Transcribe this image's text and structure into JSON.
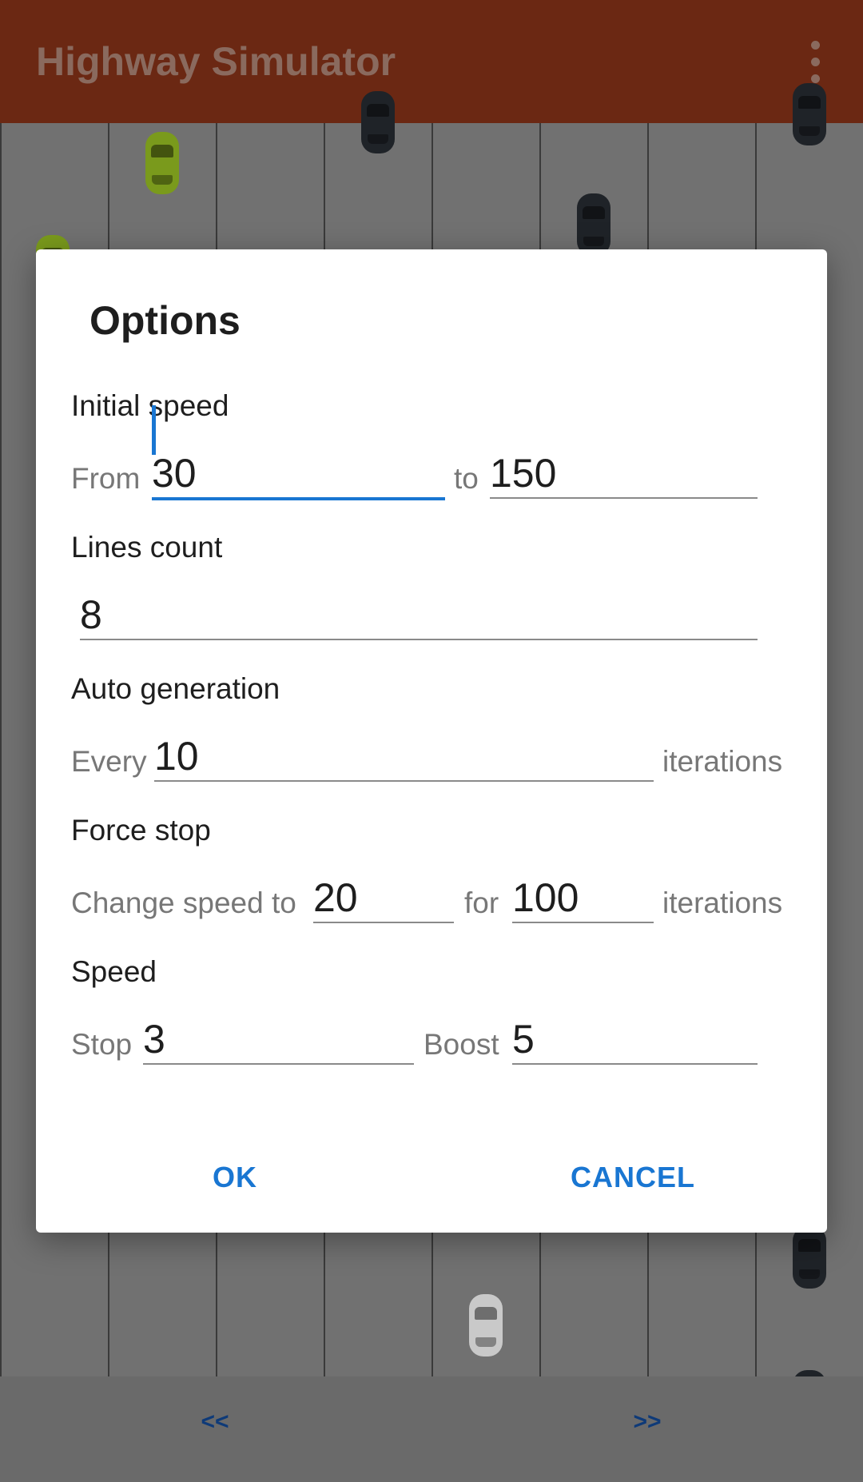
{
  "app": {
    "title": "Highway Simulator",
    "menu_icon": "more-vert-icon"
  },
  "bottom_nav": {
    "prev_label": "<<",
    "next_label": ">>"
  },
  "dialog": {
    "title": "Options",
    "initial_speed": {
      "label": "Initial speed",
      "from_prefix": "From",
      "from_value": "30",
      "to_prefix": "to",
      "to_value": "150"
    },
    "lines_count": {
      "label": "Lines count",
      "value": "8"
    },
    "auto_generation": {
      "label": "Auto generation",
      "prefix": "Every",
      "value": "10",
      "suffix": "iterations"
    },
    "force_stop": {
      "label": "Force stop",
      "prefix": "Change speed to",
      "speed_value": "20",
      "for_prefix": "for",
      "iterations_value": "100",
      "suffix": "iterations"
    },
    "speed": {
      "label": "Speed",
      "stop_prefix": "Stop",
      "stop_value": "3",
      "boost_prefix": "Boost",
      "boost_value": "5"
    },
    "ok_label": "OK",
    "cancel_label": "CANCEL"
  },
  "colors": {
    "appbar": "#6b2813",
    "accent": "#1976d2",
    "road": "#717171"
  }
}
